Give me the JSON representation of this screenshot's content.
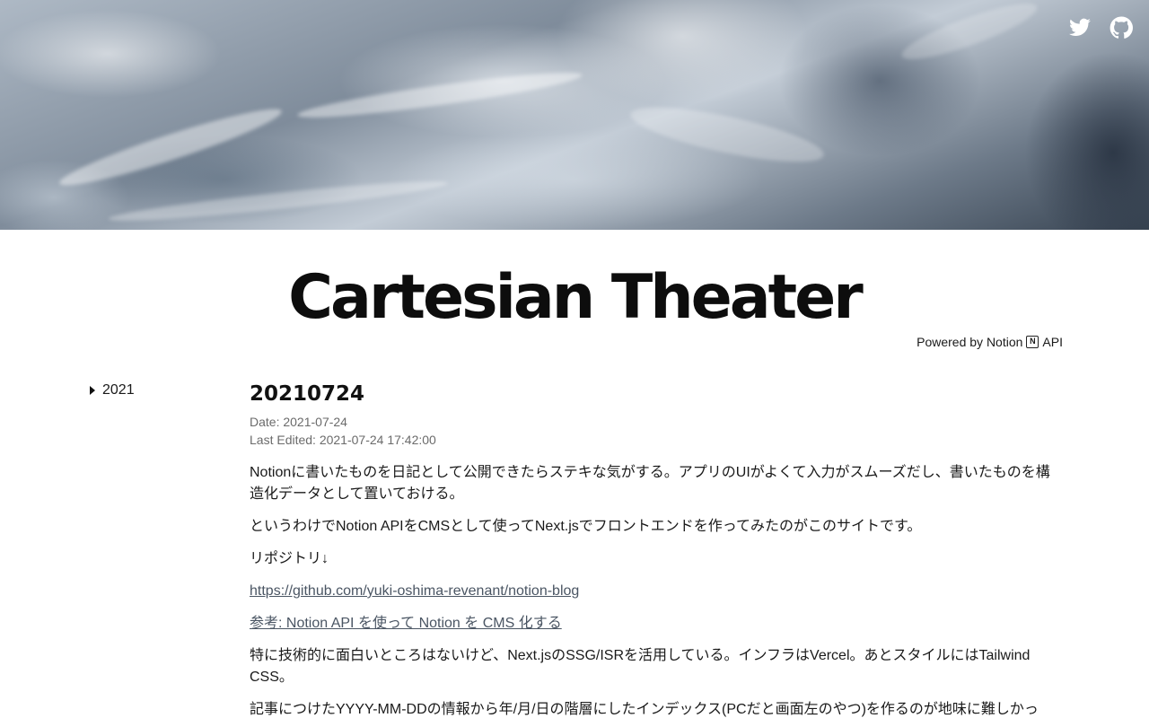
{
  "header": {
    "twitter_icon": "twitter-icon",
    "github_icon": "github-icon"
  },
  "site": {
    "title": "Cartesian Theater",
    "powered_prefix": "Powered by Notion",
    "powered_logo": "N",
    "powered_suffix": "API"
  },
  "sidebar": {
    "items": [
      {
        "label": "2021",
        "icon": "caret-right-icon"
      }
    ]
  },
  "post": {
    "title": "20210724",
    "date": "Date: 2021-07-24",
    "last_edited": "Last Edited: 2021-07-24 17:42:00",
    "paragraphs": [
      "Notionに書いたものを日記として公開できたらステキな気がする。アプリのUIがよくて入力がスムーズだし、書いたものを構造化データとして置いておける。",
      "というわけでNotion APIをCMSとして使ってNext.jsでフロントエンドを作ってみたのがこのサイトです。",
      "リポジトリ↓"
    ],
    "repo_link": "https://github.com/yuki-oshima-revenant/notion-blog",
    "ref_link": "参考: Notion API を使って Notion を CMS 化する",
    "paragraphs2": [
      "特に技術的に面白いところはないけど、Next.jsのSSG/ISRを活用している。インフラはVercel。あとスタイルにはTailwind CSS。",
      "記事につけたYYYY-MM-DDの情報から年/月/日の階層にしたインデックス(PCだと画面左のやつ)を作るのが地味に難しかっ"
    ]
  },
  "colors": {
    "link": "#4a5563",
    "meta": "#6b6b6b",
    "text": "#1a1a1a"
  }
}
